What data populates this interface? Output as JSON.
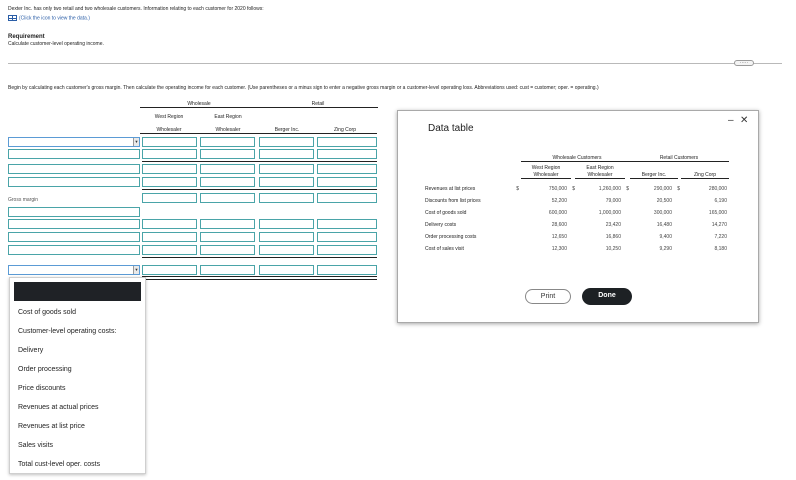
{
  "intro": {
    "text": "Dexter Inc. has only two retail and two wholesale customers. Information relating to each customer for 2020 follows:",
    "link": "(Click the icon to view the data.)"
  },
  "requirement": {
    "heading": "Requirement",
    "text": "Calculate customer-level operating income."
  },
  "more_button": "·····",
  "instruction": "Begin by calculating each customer's gross margin. Then calculate the operating income for each customer. (Use parentheses or a minus sign to enter a negative gross margin or a customer-level operating loss. Abbreviations used: cust = customer; oper. = operating.)",
  "worksheet": {
    "group_wholesale": "Wholesale",
    "group_retail": "Retail",
    "columns": [
      "West Region\nWholesaler",
      "East Region\nWholesaler",
      "Berger Inc.",
      "Zing Corp"
    ],
    "col_line1": [
      "West Region",
      "East Region",
      "",
      ""
    ],
    "col_line2": [
      "Wholesaler",
      "Wholesaler",
      "Berger Inc.",
      "Zing Corp"
    ],
    "gross_margin_label": "Gross margin"
  },
  "dropdown": {
    "options": [
      "Cost of goods sold",
      "Customer-level operating costs:",
      "Delivery",
      "Order processing",
      "Price discounts",
      "Revenues at actual prices",
      "Revenues at list price",
      "Sales visits",
      "Total cust-level oper. costs"
    ]
  },
  "data_table": {
    "title": "Data table",
    "minimize": "–",
    "close": "✕",
    "group_wholesale": "Wholesale Customers",
    "group_retail": "Retail Customers",
    "col1a": "West Region",
    "col1b": "Wholesaler",
    "col2a": "East Region",
    "col2b": "Wholesaler",
    "col3": "Berger Inc.",
    "col4": "Zing Corp",
    "rows": [
      {
        "label": "Revenues at list prices",
        "cur": "$",
        "v": [
          "750,000",
          "1,260,000",
          "290,000",
          "280,000"
        ],
        "dollar": true
      },
      {
        "label": "Discounts from list prices",
        "cur": "",
        "v": [
          "52,200",
          "79,000",
          "20,500",
          "6,190"
        ]
      },
      {
        "label": "Cost of goods sold",
        "cur": "",
        "v": [
          "600,000",
          "1,000,000",
          "300,000",
          "165,000"
        ]
      },
      {
        "label": "Delivery costs",
        "cur": "",
        "v": [
          "28,600",
          "23,420",
          "16,480",
          "14,270"
        ]
      },
      {
        "label": "Order processing costs",
        "cur": "",
        "v": [
          "12,650",
          "16,860",
          "9,400",
          "7,220"
        ]
      },
      {
        "label": "Cost of sales visit",
        "cur": "",
        "v": [
          "12,300",
          "10,250",
          "9,290",
          "8,180"
        ]
      }
    ],
    "dollar_sign": "$",
    "print_label": "Print",
    "done_label": "Done"
  }
}
